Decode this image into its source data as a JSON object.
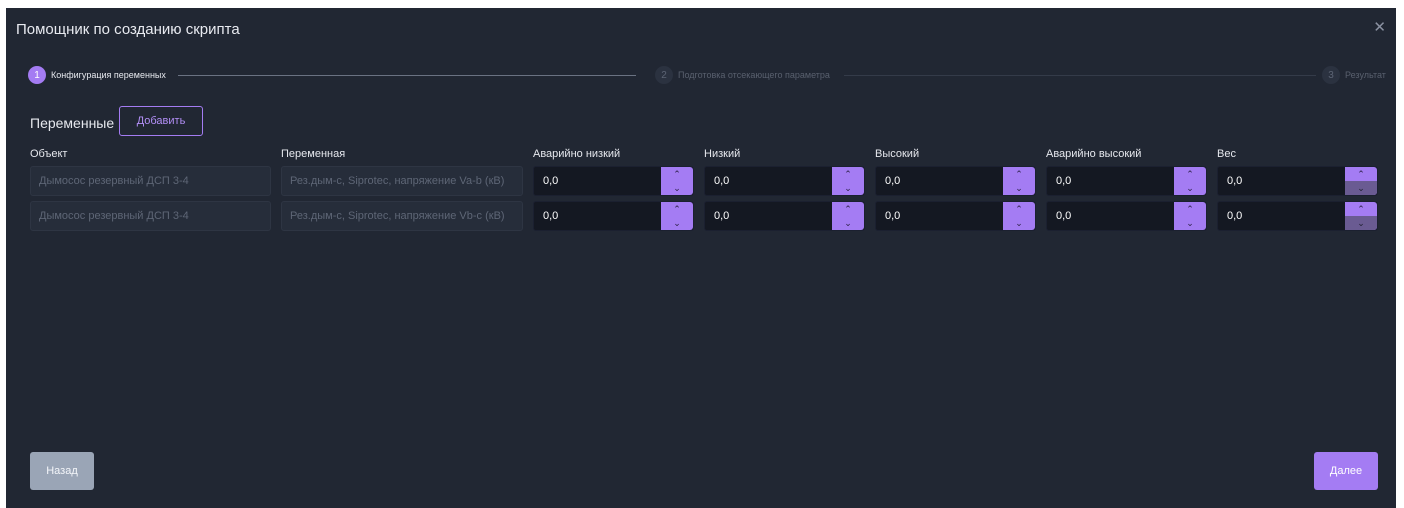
{
  "dialog": {
    "title": "Помощник по созданию скрипта",
    "close_icon": "close-icon"
  },
  "stepper": {
    "steps": [
      {
        "number": "1",
        "label": "Конфигурация переменных",
        "active": true
      },
      {
        "number": "2",
        "label": "Подготовка отсекающего параметра",
        "active": false
      },
      {
        "number": "3",
        "label": "Результат",
        "active": false
      }
    ]
  },
  "variables": {
    "title": "Переменные",
    "add_label": "Добавить",
    "columns": [
      "Объект",
      "Переменная",
      "Аварийно низкий",
      "Низкий",
      "Высокий",
      "Аварийно высокий",
      "Вес"
    ],
    "rows": [
      {
        "object": "Дымосос резервный ДСП 3-4",
        "variable": "Рез.дым-с, Siprotec, напряжение Va-b (кВ)",
        "values": [
          "0,0",
          "0,0",
          "0,0",
          "0,0",
          "0,0"
        ]
      },
      {
        "object": "Дымосос резервный ДСП 3-4",
        "variable": "Рез.дым-с, Siprotec, напряжение Vb-c (кВ)",
        "values": [
          "0,0",
          "0,0",
          "0,0",
          "0,0",
          "0,0"
        ]
      }
    ]
  },
  "footer": {
    "back_label": "Назад",
    "next_label": "Далее"
  },
  "colors": {
    "accent": "#a47cf3",
    "background": "#212733",
    "input_dark": "#141822",
    "back_button": "#9aa5b6"
  }
}
